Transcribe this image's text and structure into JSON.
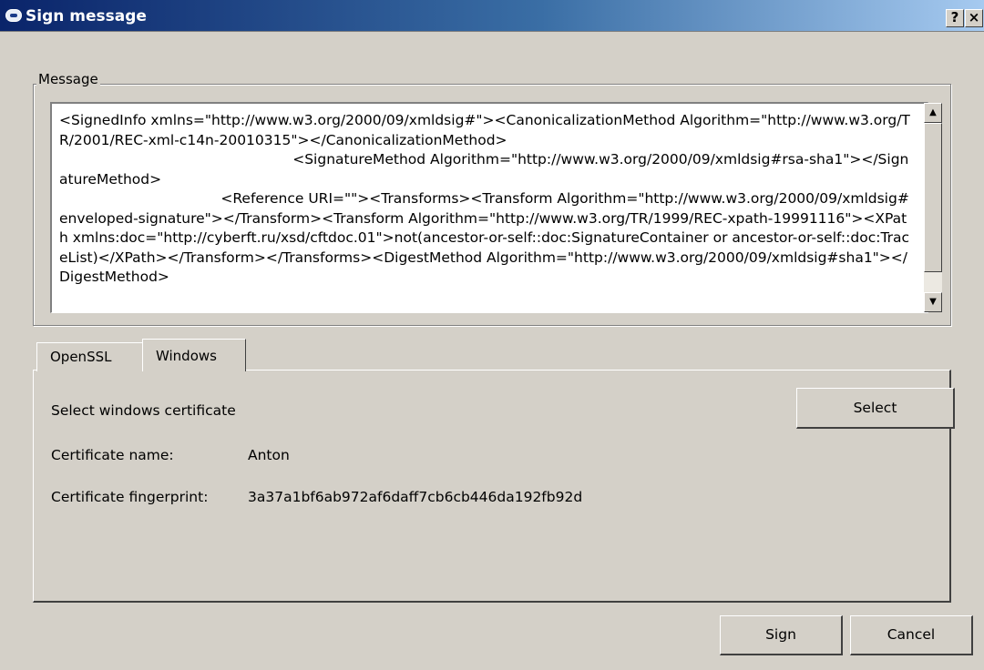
{
  "window": {
    "title": "Sign message",
    "help_label": "?",
    "close_label": "×"
  },
  "message_group": {
    "label": "Message",
    "text": "<SignedInfo xmlns=\"http://www.w3.org/2000/09/xmldsig#\"><CanonicalizationMethod Algorithm=\"http://www.w3.org/TR/2001/REC-xml-c14n-20010315\"></CanonicalizationMethod>\n                                                    <SignatureMethod Algorithm=\"http://www.w3.org/2000/09/xmldsig#rsa-sha1\"></SignatureMethod>\n                                    <Reference URI=\"\"><Transforms><Transform Algorithm=\"http://www.w3.org/2000/09/xmldsig#enveloped-signature\"></Transform><Transform Algorithm=\"http://www.w3.org/TR/1999/REC-xpath-19991116\"><XPath xmlns:doc=\"http://cyberft.ru/xsd/cftdoc.01\">not(ancestor-or-self::doc:SignatureContainer or ancestor-or-self::doc:TraceList)</XPath></Transform></Transforms><DigestMethod Algorithm=\"http://www.w3.org/2000/09/xmldsig#sha1\"></DigestMethod>"
  },
  "tabs": [
    {
      "label": "OpenSSL"
    },
    {
      "label": "Windows"
    }
  ],
  "windows_tab": {
    "select_label": "Select windows certificate",
    "select_button": "Select",
    "cert_name_label": "Certificate name:",
    "cert_name_value": "Anton",
    "cert_fp_label": "Certificate fingerprint:",
    "cert_fp_value": "3a37a1bf6ab972af6daff7cb6cb446da192fb92d"
  },
  "footer": {
    "sign_button": "Sign",
    "cancel_button": "Cancel"
  }
}
